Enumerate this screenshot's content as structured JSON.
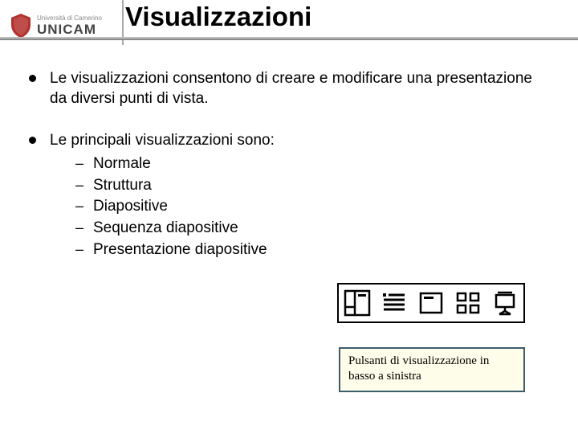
{
  "header": {
    "logo_line1": "Università di Camerino",
    "logo_brand": "UNICAM",
    "title": "Visualizzazioni"
  },
  "body": {
    "para1": "Le visualizzazioni consentono di creare e modificare una presentazione da diversi punti di vista.",
    "para2_intro": "Le principali visualizzazioni sono:",
    "sub": {
      "0": "Normale",
      "1": "Struttura",
      "2": "Diapositive",
      "3": "Sequenza diapositive",
      "4": "Presentazione diapositive"
    }
  },
  "icons": {
    "0": "normal-view-icon",
    "1": "outline-view-icon",
    "2": "slide-view-icon",
    "3": "slide-sorter-icon",
    "4": "slideshow-icon"
  },
  "caption": "Pulsanti di visualizzazione in basso a sinistra"
}
